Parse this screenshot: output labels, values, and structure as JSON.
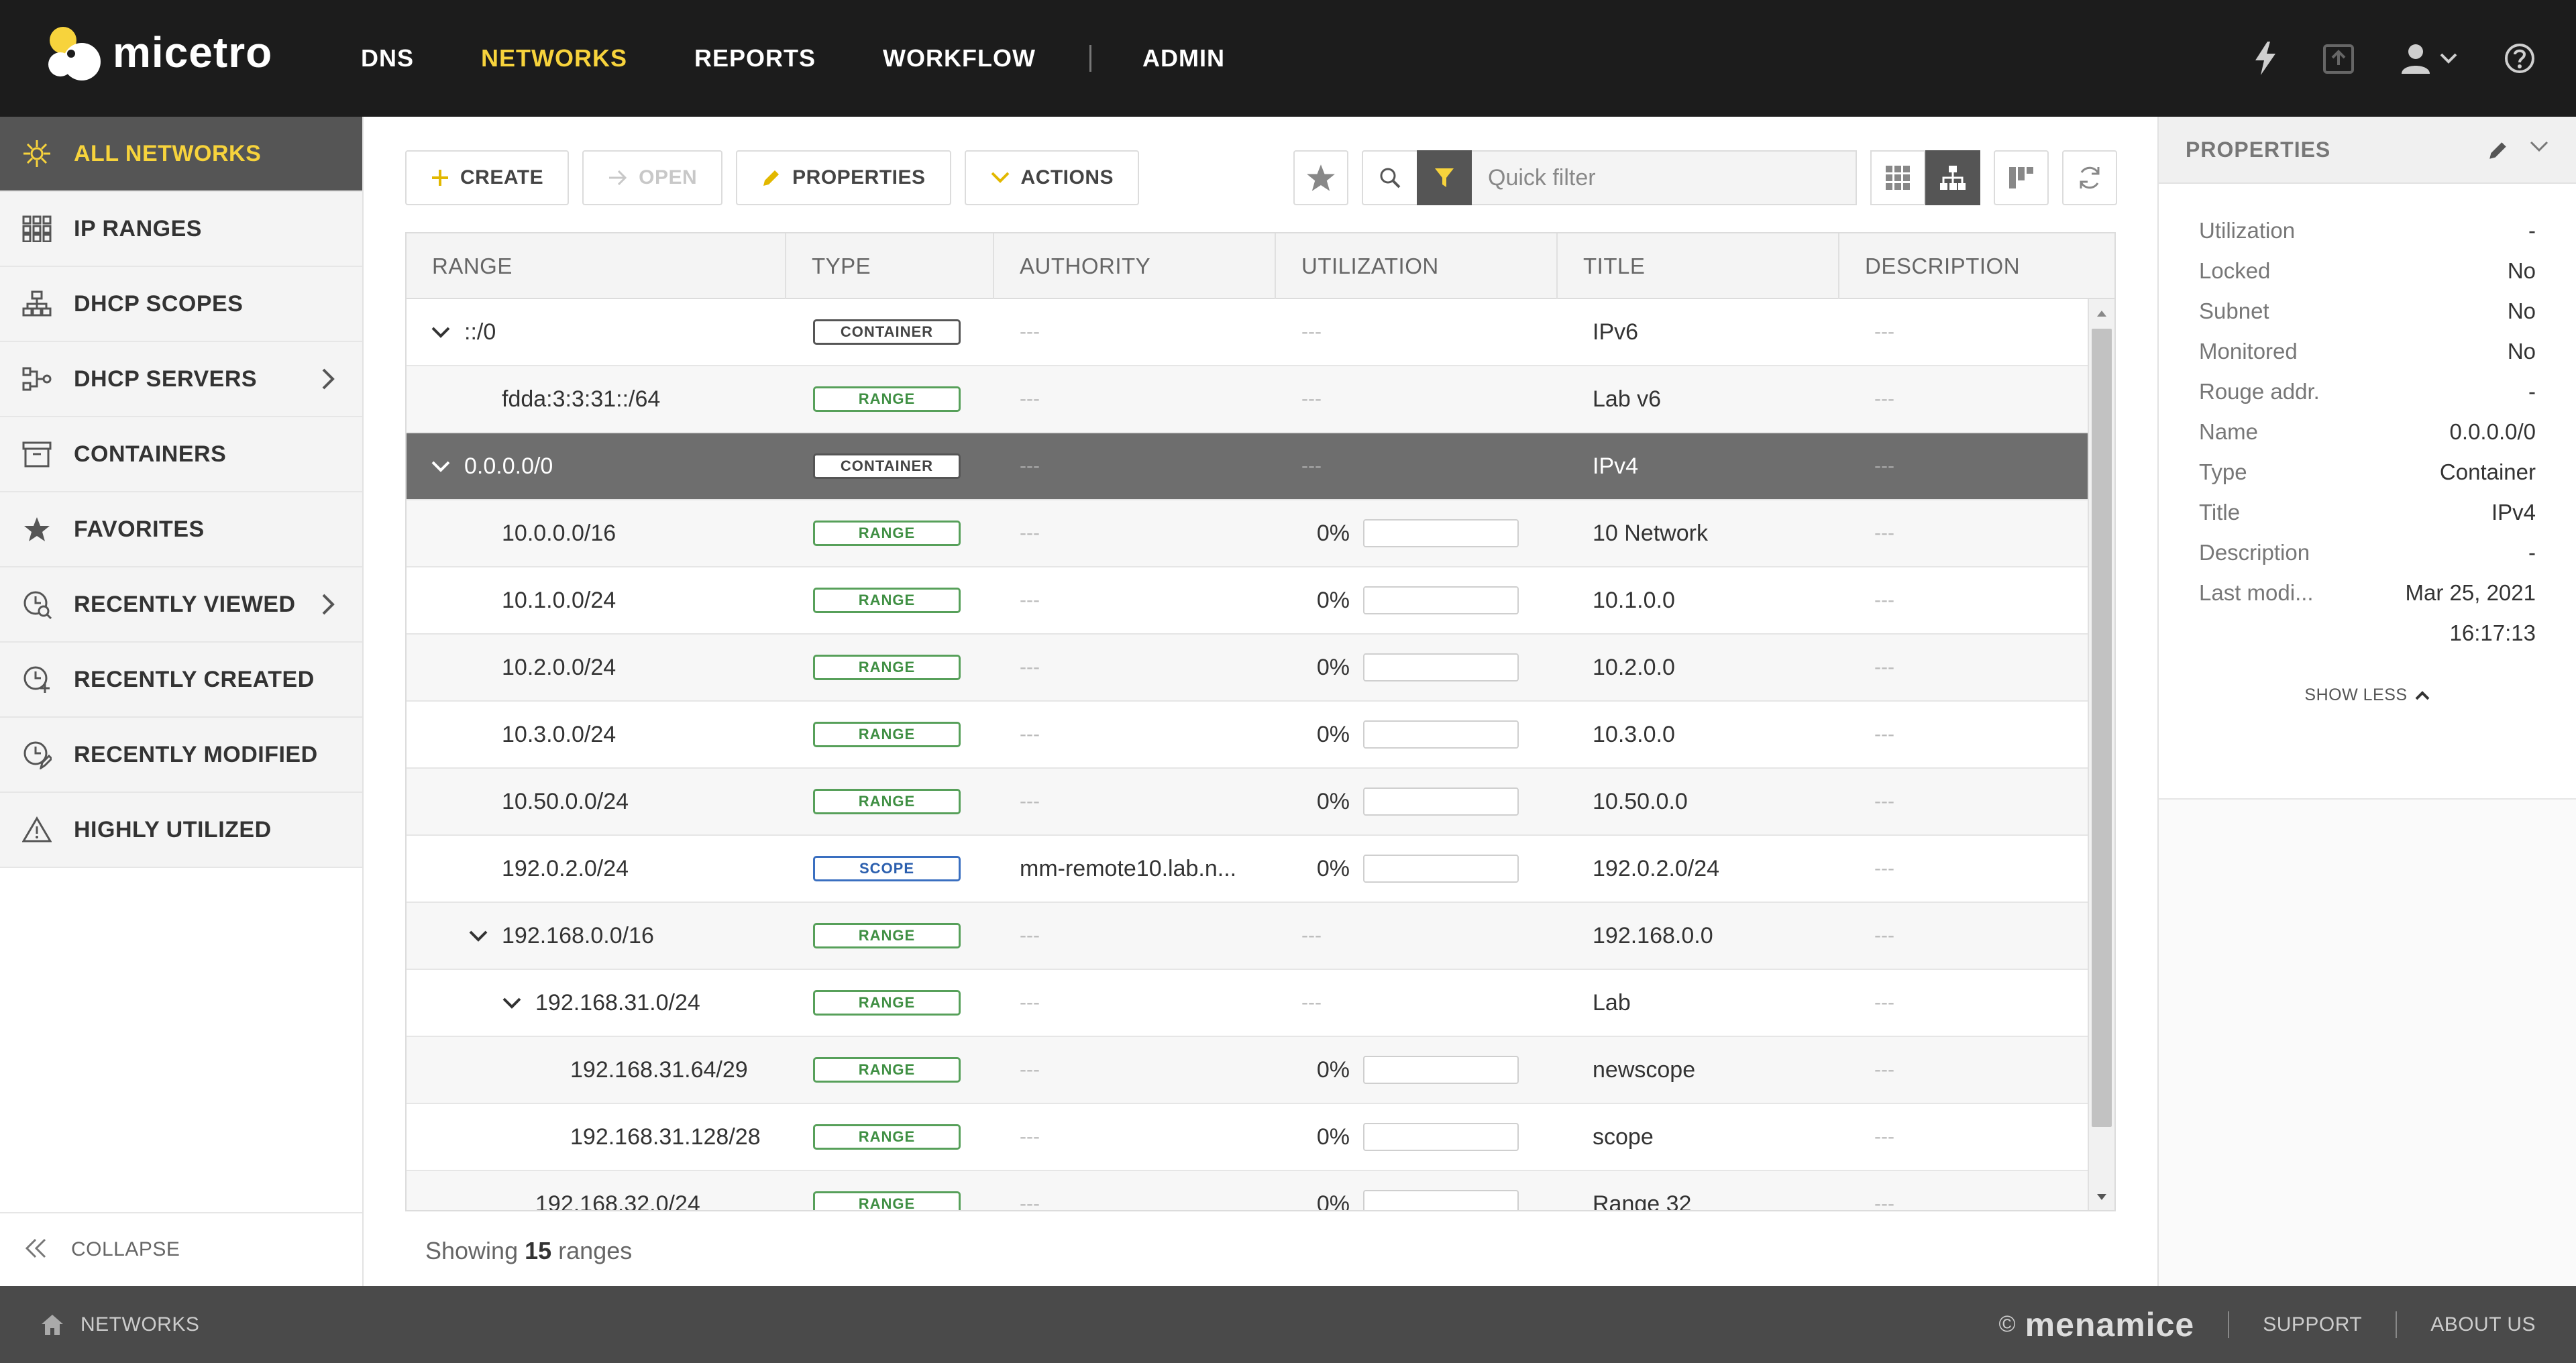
{
  "app": {
    "name": "micetro"
  },
  "topnav": {
    "items": [
      {
        "label": "DNS",
        "active": false
      },
      {
        "label": "NETWORKS",
        "active": true
      },
      {
        "label": "REPORTS",
        "active": false
      },
      {
        "label": "WORKFLOW",
        "active": false
      }
    ],
    "admin": "ADMIN",
    "icons": [
      "lightning-icon",
      "import-icon",
      "user-icon",
      "help-icon"
    ]
  },
  "sidebar": {
    "items": [
      {
        "label": "ALL NETWORKS",
        "icon": "network-icon",
        "active": true
      },
      {
        "label": "IP RANGES",
        "icon": "grid-icon"
      },
      {
        "label": "DHCP SCOPES",
        "icon": "hierarchy-icon"
      },
      {
        "label": "DHCP SERVERS",
        "icon": "server-icon",
        "expandable": true
      },
      {
        "label": "CONTAINERS",
        "icon": "archive-icon"
      },
      {
        "label": "FAVORITES",
        "icon": "star-icon"
      },
      {
        "label": "RECENTLY VIEWED",
        "icon": "view-history-icon",
        "expandable": true
      },
      {
        "label": "RECENTLY CREATED",
        "icon": "clock-plus-icon"
      },
      {
        "label": "RECENTLY MODIFIED",
        "icon": "clock-edit-icon"
      },
      {
        "label": "HIGHLY UTILIZED",
        "icon": "warning-icon"
      }
    ],
    "collapse": "COLLAPSE"
  },
  "toolbar": {
    "create": "CREATE",
    "open": "OPEN",
    "properties": "PROPERTIES",
    "actions": "ACTIONS",
    "quick_filter_placeholder": "Quick filter"
  },
  "table": {
    "columns": [
      "RANGE",
      "TYPE",
      "AUTHORITY",
      "UTILIZATION",
      "TITLE",
      "DESCRIPTION"
    ],
    "rows": [
      {
        "range": "::/0",
        "depth": 0,
        "toggle": true,
        "type": "CONTAINER",
        "authority": "---",
        "util": null,
        "title": "IPv6",
        "description": "---"
      },
      {
        "range": "fdda:3:3:31::/64",
        "depth": 1,
        "toggle": false,
        "type": "RANGE",
        "authority": "---",
        "util": null,
        "title": "Lab v6",
        "description": "---"
      },
      {
        "range": "0.0.0.0/0",
        "depth": 0,
        "toggle": true,
        "type": "CONTAINER",
        "authority": "---",
        "util": null,
        "title": "IPv4",
        "description": "---",
        "selected": true
      },
      {
        "range": "10.0.0.0/16",
        "depth": 1,
        "toggle": false,
        "type": "RANGE",
        "authority": "---",
        "util": "0%",
        "title": "10 Network",
        "description": "---"
      },
      {
        "range": "10.1.0.0/24",
        "depth": 1,
        "toggle": false,
        "type": "RANGE",
        "authority": "---",
        "util": "0%",
        "title": "10.1.0.0",
        "description": "---"
      },
      {
        "range": "10.2.0.0/24",
        "depth": 1,
        "toggle": false,
        "type": "RANGE",
        "authority": "---",
        "util": "0%",
        "title": "10.2.0.0",
        "description": "---"
      },
      {
        "range": "10.3.0.0/24",
        "depth": 1,
        "toggle": false,
        "type": "RANGE",
        "authority": "---",
        "util": "0%",
        "title": "10.3.0.0",
        "description": "---"
      },
      {
        "range": "10.50.0.0/24",
        "depth": 1,
        "toggle": false,
        "type": "RANGE",
        "authority": "---",
        "util": "0%",
        "title": "10.50.0.0",
        "description": "---"
      },
      {
        "range": "192.0.2.0/24",
        "depth": 1,
        "toggle": false,
        "type": "SCOPE",
        "authority": "mm-remote10.lab.n...",
        "util": "0%",
        "title": "192.0.2.0/24",
        "description": "---"
      },
      {
        "range": "192.168.0.0/16",
        "depth": 1,
        "toggle": true,
        "type": "RANGE",
        "authority": "---",
        "util": null,
        "title": "192.168.0.0",
        "description": "---"
      },
      {
        "range": "192.168.31.0/24",
        "depth": 2,
        "toggle": true,
        "type": "RANGE",
        "authority": "---",
        "util": null,
        "title": "Lab",
        "description": "---"
      },
      {
        "range": "192.168.31.64/29",
        "depth": 3,
        "toggle": false,
        "type": "RANGE",
        "authority": "---",
        "util": "0%",
        "title": "newscope",
        "description": "---"
      },
      {
        "range": "192.168.31.128/28",
        "depth": 3,
        "toggle": false,
        "type": "RANGE",
        "authority": "---",
        "util": "0%",
        "title": "scope",
        "description": "---"
      },
      {
        "range": "192.168.32.0/24",
        "depth": 2,
        "toggle": false,
        "type": "RANGE",
        "authority": "---",
        "util": "0%",
        "title": "Range 32",
        "description": "---"
      }
    ],
    "util_empty": "---",
    "showing_prefix": "Showing",
    "showing_count": "15",
    "showing_suffix": "ranges"
  },
  "properties": {
    "title": "PROPERTIES",
    "rows": [
      {
        "key": "Utilization",
        "value": "-"
      },
      {
        "key": "Locked",
        "value": "No"
      },
      {
        "key": "Subnet",
        "value": "No"
      },
      {
        "key": "Monitored",
        "value": "No"
      },
      {
        "key": "Rouge addr.",
        "value": "-"
      },
      {
        "key": "Name",
        "value": "0.0.0.0/0"
      },
      {
        "key": "Type",
        "value": "Container"
      },
      {
        "key": "Title",
        "value": "IPv4"
      },
      {
        "key": "Description",
        "value": "-"
      },
      {
        "key": "Last modi...",
        "value": "Mar 25, 2021"
      }
    ],
    "last_modified_time": "16:17:13",
    "show_less": "SHOW LESS"
  },
  "footer": {
    "crumb": "NETWORKS",
    "copyright": "©",
    "brand": "menamice",
    "support": "SUPPORT",
    "about": "ABOUT US"
  },
  "colors": {
    "accent": "#f7d33c",
    "header": "#1c1c1c",
    "range_badge": "#57a05a",
    "scope_badge": "#3a6fc0",
    "selected_row": "#6e6e6e",
    "footer": "#4a4a4a"
  }
}
